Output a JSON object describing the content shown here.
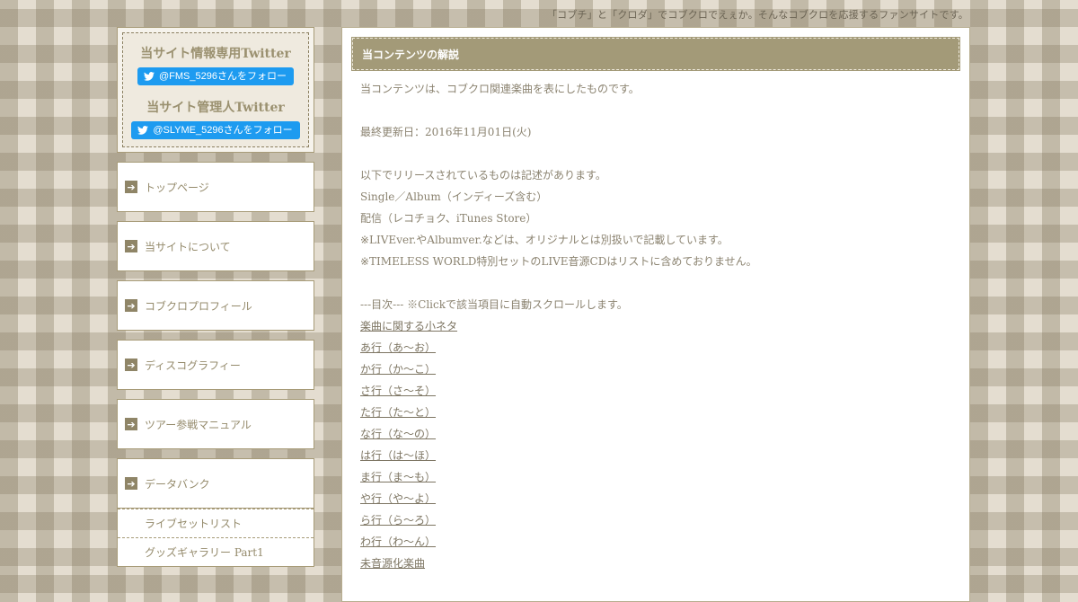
{
  "site": {
    "tagline": "「コブチ」と「クロダ」でコブクロでえぇか。そんなコブクロを応援するファンサイトです。"
  },
  "sidebar": {
    "twitter": [
      {
        "heading": "当サイト情報専用Twitter",
        "button": "@FMS_5296さんをフォロー"
      },
      {
        "heading": "当サイト管理人Twitter",
        "button": "@SLYME_5296さんをフォロー"
      }
    ],
    "nav": [
      {
        "label": "トップページ"
      },
      {
        "label": "当サイトについて"
      },
      {
        "label": "コブクロプロフィール"
      },
      {
        "label": "ディスコグラフィー"
      },
      {
        "label": "ツアー参戦マニュアル"
      },
      {
        "label": "データバンク"
      }
    ],
    "sub_items": [
      {
        "label": "ライブセットリスト"
      },
      {
        "label": "グッズギャラリー Part1"
      }
    ]
  },
  "main": {
    "title": "当コンテンツの解説",
    "intro": "当コンテンツは、コブクロ関連楽曲を表にしたものです。",
    "updated": "最終更新日：2016年11月01日(火)",
    "notes": [
      "以下でリリースされているものは記述があります。",
      "Single／Album（インディーズ含む）",
      "配信（レコチョク、iTunes Store）",
      "※LIVEver.やAlbumver.などは、オリジナルとは別扱いで記載しています。",
      "※TIMELESS WORLD特別セットのLIVE音源CDはリストに含めておりません。"
    ],
    "toc_heading": "---目次--- ※Clickで該当項目に自動スクロールします。",
    "toc": [
      "楽曲に関する小ネタ",
      "あ行（あ～お）",
      "か行（か～こ）",
      "さ行（さ～そ）",
      "た行（た～と）",
      "な行（な～の）",
      "は行（は～ほ）",
      "ま行（ま～も）",
      "や行（や～よ）",
      "ら行（ら～ろ）",
      "わ行（わ～ん）",
      "未音源化楽曲"
    ]
  },
  "colors": {
    "header_bg": "#a39a78",
    "twitter_blue": "#1d9bf0",
    "text_muted": "#8b8370"
  }
}
